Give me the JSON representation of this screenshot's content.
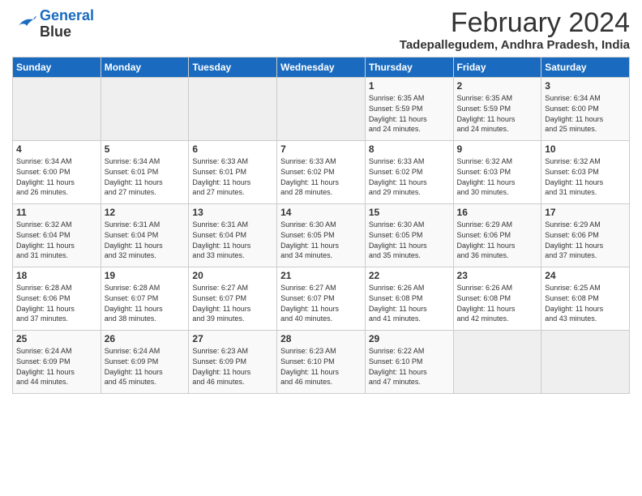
{
  "logo": {
    "line1": "General",
    "line2": "Blue"
  },
  "title": "February 2024",
  "location": "Tadepallegudem, Andhra Pradesh, India",
  "days_of_week": [
    "Sunday",
    "Monday",
    "Tuesday",
    "Wednesday",
    "Thursday",
    "Friday",
    "Saturday"
  ],
  "weeks": [
    [
      {
        "day": "",
        "info": ""
      },
      {
        "day": "",
        "info": ""
      },
      {
        "day": "",
        "info": ""
      },
      {
        "day": "",
        "info": ""
      },
      {
        "day": "1",
        "info": "Sunrise: 6:35 AM\nSunset: 5:59 PM\nDaylight: 11 hours\nand 24 minutes."
      },
      {
        "day": "2",
        "info": "Sunrise: 6:35 AM\nSunset: 5:59 PM\nDaylight: 11 hours\nand 24 minutes."
      },
      {
        "day": "3",
        "info": "Sunrise: 6:34 AM\nSunset: 6:00 PM\nDaylight: 11 hours\nand 25 minutes."
      }
    ],
    [
      {
        "day": "4",
        "info": "Sunrise: 6:34 AM\nSunset: 6:00 PM\nDaylight: 11 hours\nand 26 minutes."
      },
      {
        "day": "5",
        "info": "Sunrise: 6:34 AM\nSunset: 6:01 PM\nDaylight: 11 hours\nand 27 minutes."
      },
      {
        "day": "6",
        "info": "Sunrise: 6:33 AM\nSunset: 6:01 PM\nDaylight: 11 hours\nand 27 minutes."
      },
      {
        "day": "7",
        "info": "Sunrise: 6:33 AM\nSunset: 6:02 PM\nDaylight: 11 hours\nand 28 minutes."
      },
      {
        "day": "8",
        "info": "Sunrise: 6:33 AM\nSunset: 6:02 PM\nDaylight: 11 hours\nand 29 minutes."
      },
      {
        "day": "9",
        "info": "Sunrise: 6:32 AM\nSunset: 6:03 PM\nDaylight: 11 hours\nand 30 minutes."
      },
      {
        "day": "10",
        "info": "Sunrise: 6:32 AM\nSunset: 6:03 PM\nDaylight: 11 hours\nand 31 minutes."
      }
    ],
    [
      {
        "day": "11",
        "info": "Sunrise: 6:32 AM\nSunset: 6:04 PM\nDaylight: 11 hours\nand 31 minutes."
      },
      {
        "day": "12",
        "info": "Sunrise: 6:31 AM\nSunset: 6:04 PM\nDaylight: 11 hours\nand 32 minutes."
      },
      {
        "day": "13",
        "info": "Sunrise: 6:31 AM\nSunset: 6:04 PM\nDaylight: 11 hours\nand 33 minutes."
      },
      {
        "day": "14",
        "info": "Sunrise: 6:30 AM\nSunset: 6:05 PM\nDaylight: 11 hours\nand 34 minutes."
      },
      {
        "day": "15",
        "info": "Sunrise: 6:30 AM\nSunset: 6:05 PM\nDaylight: 11 hours\nand 35 minutes."
      },
      {
        "day": "16",
        "info": "Sunrise: 6:29 AM\nSunset: 6:06 PM\nDaylight: 11 hours\nand 36 minutes."
      },
      {
        "day": "17",
        "info": "Sunrise: 6:29 AM\nSunset: 6:06 PM\nDaylight: 11 hours\nand 37 minutes."
      }
    ],
    [
      {
        "day": "18",
        "info": "Sunrise: 6:28 AM\nSunset: 6:06 PM\nDaylight: 11 hours\nand 37 minutes."
      },
      {
        "day": "19",
        "info": "Sunrise: 6:28 AM\nSunset: 6:07 PM\nDaylight: 11 hours\nand 38 minutes."
      },
      {
        "day": "20",
        "info": "Sunrise: 6:27 AM\nSunset: 6:07 PM\nDaylight: 11 hours\nand 39 minutes."
      },
      {
        "day": "21",
        "info": "Sunrise: 6:27 AM\nSunset: 6:07 PM\nDaylight: 11 hours\nand 40 minutes."
      },
      {
        "day": "22",
        "info": "Sunrise: 6:26 AM\nSunset: 6:08 PM\nDaylight: 11 hours\nand 41 minutes."
      },
      {
        "day": "23",
        "info": "Sunrise: 6:26 AM\nSunset: 6:08 PM\nDaylight: 11 hours\nand 42 minutes."
      },
      {
        "day": "24",
        "info": "Sunrise: 6:25 AM\nSunset: 6:08 PM\nDaylight: 11 hours\nand 43 minutes."
      }
    ],
    [
      {
        "day": "25",
        "info": "Sunrise: 6:24 AM\nSunset: 6:09 PM\nDaylight: 11 hours\nand 44 minutes."
      },
      {
        "day": "26",
        "info": "Sunrise: 6:24 AM\nSunset: 6:09 PM\nDaylight: 11 hours\nand 45 minutes."
      },
      {
        "day": "27",
        "info": "Sunrise: 6:23 AM\nSunset: 6:09 PM\nDaylight: 11 hours\nand 46 minutes."
      },
      {
        "day": "28",
        "info": "Sunrise: 6:23 AM\nSunset: 6:10 PM\nDaylight: 11 hours\nand 46 minutes."
      },
      {
        "day": "29",
        "info": "Sunrise: 6:22 AM\nSunset: 6:10 PM\nDaylight: 11 hours\nand 47 minutes."
      },
      {
        "day": "",
        "info": ""
      },
      {
        "day": "",
        "info": ""
      }
    ]
  ]
}
